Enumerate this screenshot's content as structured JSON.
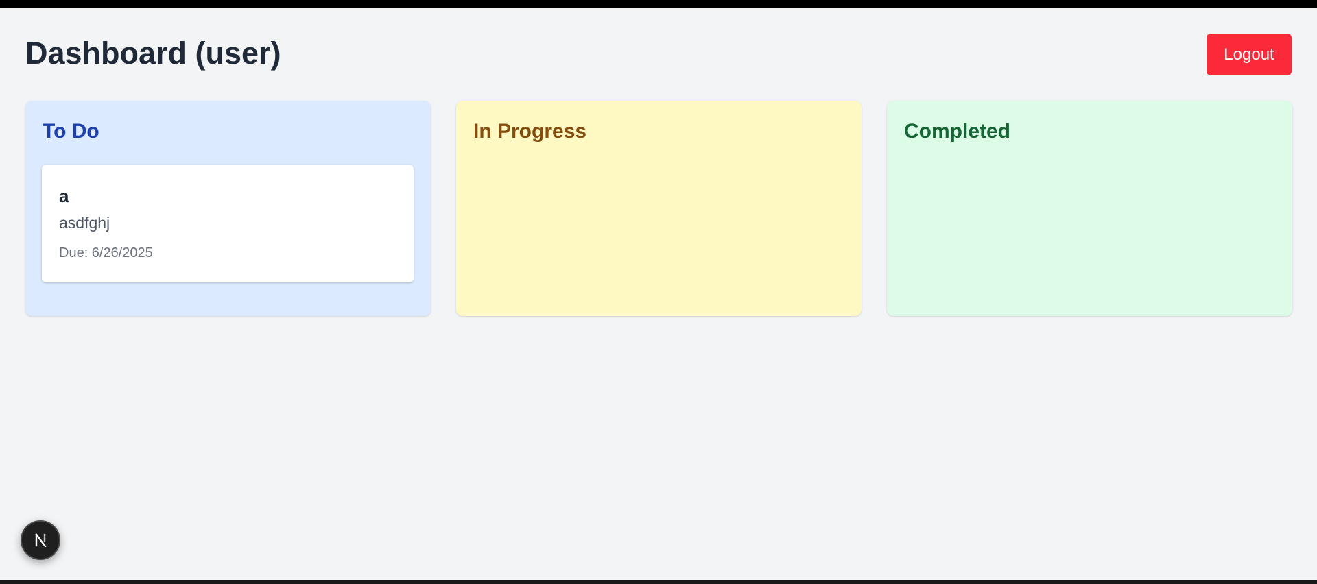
{
  "header": {
    "title": "Dashboard (user)",
    "logout_label": "Logout"
  },
  "columns": [
    {
      "id": "todo",
      "title": "To Do",
      "color": "#1e40af",
      "background": "#dbeafe",
      "tasks": [
        {
          "title": "a",
          "description": "asdfghj",
          "due": "Due: 6/26/2025"
        }
      ]
    },
    {
      "id": "in-progress",
      "title": "In Progress",
      "color": "#854d0e",
      "background": "#fef9c3",
      "tasks": []
    },
    {
      "id": "completed",
      "title": "Completed",
      "color": "#166534",
      "background": "#dcfce7",
      "tasks": []
    }
  ],
  "dev_badge": {
    "icon": "nextjs-logo-icon"
  },
  "colors": {
    "accent_danger": "#fb2a3a",
    "page_background": "#f3f4f6"
  }
}
